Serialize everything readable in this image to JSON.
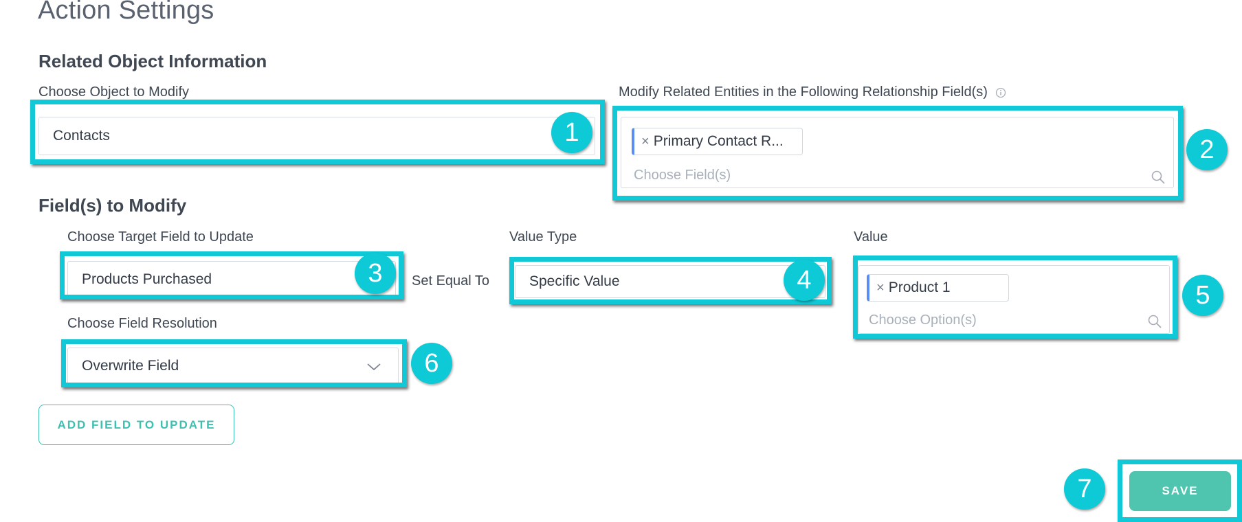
{
  "page": {
    "title": "Action Settings"
  },
  "related": {
    "heading": "Related Object Information",
    "object_label": "Choose Object to Modify",
    "object_value": "Contacts",
    "relationship_label": "Modify Related Entities in the Following Relationship Field(s)",
    "relationship_chip": "Primary Contact R...",
    "relationship_placeholder": "Choose Field(s)"
  },
  "fields": {
    "heading": "Field(s) to Modify",
    "target_label": "Choose Target Field to Update",
    "target_value": "Products Purchased",
    "set_equal_to": "Set Equal To",
    "value_type_label": "Value Type",
    "value_type_value": "Specific Value",
    "value_label": "Value",
    "value_chip": "Product 1",
    "value_placeholder": "Choose Option(s)",
    "resolution_label": "Choose Field Resolution",
    "resolution_value": "Overwrite Field"
  },
  "buttons": {
    "add_field": "ADD FIELD TO UPDATE",
    "save": "SAVE"
  },
  "badges": [
    "1",
    "2",
    "3",
    "4",
    "5",
    "6",
    "7"
  ],
  "colors": {
    "highlight": "#10c8d6",
    "badge": "#0ec9d6",
    "accent": "#3cc1b0",
    "chip_bar": "#5b8df0"
  },
  "icons": {
    "remove": "×",
    "search": "search-icon",
    "info": "info-icon",
    "chevron": "chevron-down-icon"
  }
}
